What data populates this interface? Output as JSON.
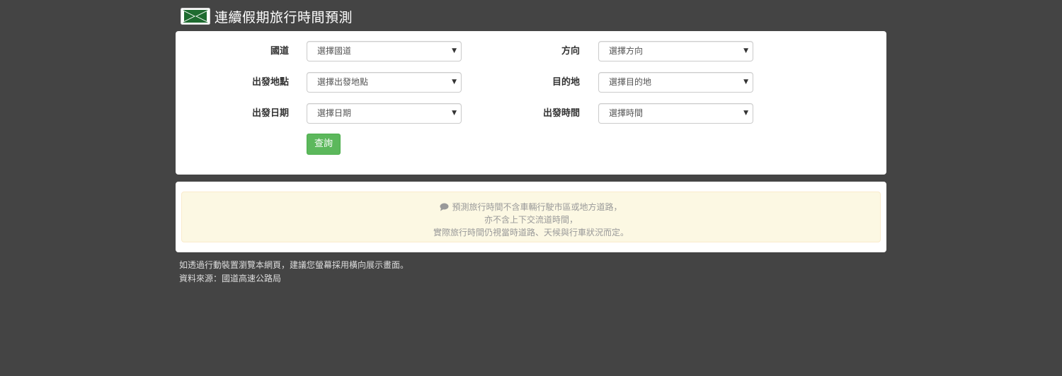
{
  "header": {
    "title": "連續假期旅行時間預測",
    "logo_icon": "highway-logo-icon"
  },
  "form": {
    "fields": [
      {
        "label": "國道",
        "value": "選擇國道"
      },
      {
        "label": "方向",
        "value": "選擇方向"
      },
      {
        "label": "出發地點",
        "value": "選擇出發地點"
      },
      {
        "label": "目的地",
        "value": "選擇目的地"
      },
      {
        "label": "出發日期",
        "value": "選擇日期"
      },
      {
        "label": "出發時間",
        "value": "選擇時間"
      }
    ],
    "query_button": "查詢",
    "dropdown_icon": "chevron-down-icon"
  },
  "notice": {
    "icon": "comment-icon",
    "lines": [
      "預測旅行時間不含車輛行駛市區或地方道路，",
      "亦不含上下交流道時間，",
      "實際旅行時間仍視當時道路、天候與行車狀況而定。"
    ]
  },
  "footer": {
    "lines": [
      "如透過行動裝置瀏覽本網頁，建議您螢幕採用橫向展示畫面。",
      "資料來源：國道高速公路局"
    ]
  },
  "colors": {
    "background": "#444444",
    "panel": "#ffffff",
    "button": "#5cb85c",
    "alert_bg": "#fcf8e3",
    "logo_green": "#1e6b30"
  }
}
